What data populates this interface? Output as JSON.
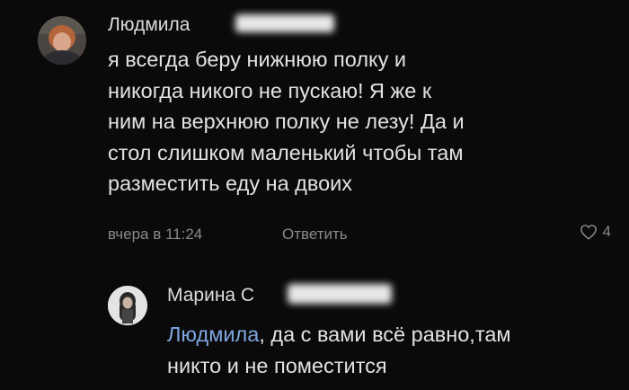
{
  "comment1": {
    "author": "Людмила",
    "text_lines": [
      "я всегда беру нижнюю полку и",
      "никогда никого не пускаю! Я же к",
      "ним на верхнюю полку не лезу! Да и",
      "стол слишком маленький чтобы там",
      "разместить еду на двоих"
    ],
    "time": "вчера в 11:24",
    "reply_label": "Ответить",
    "likes": "4"
  },
  "comment2": {
    "author": "Марина С",
    "mention": "Людмила",
    "text_line1_rest": ", да с вами всё равно,там",
    "text_line2": "никто и не поместится"
  },
  "colors": {
    "background": "#0a0a0a",
    "text": "#e2e2e2",
    "meta": "#8a8a8a",
    "mention": "#7fa6e0"
  },
  "icons": {
    "like": "heart-outline-icon"
  }
}
